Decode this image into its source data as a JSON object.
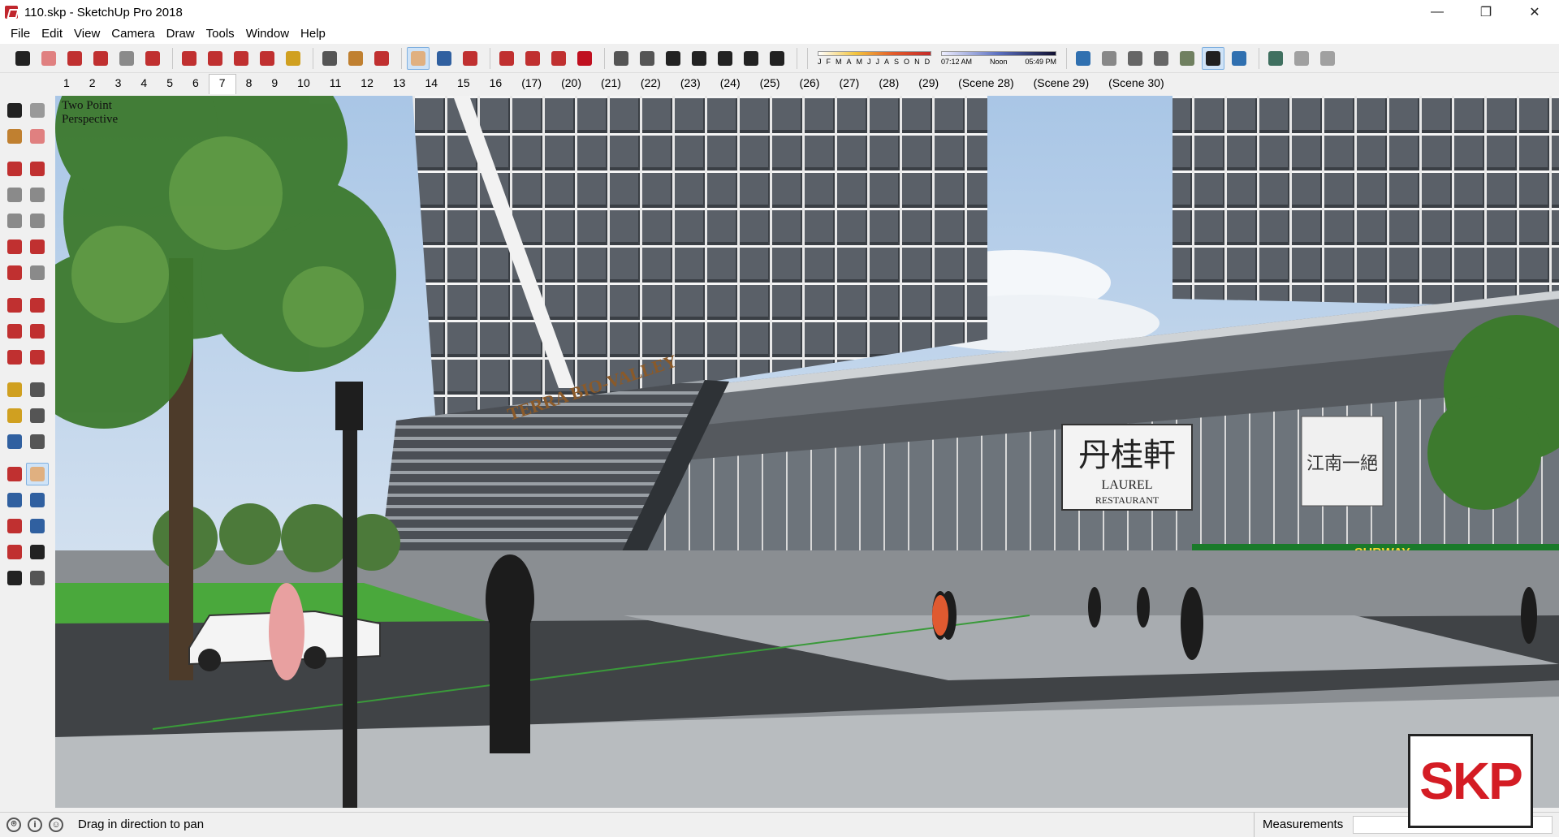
{
  "window": {
    "title": "110.skp - SketchUp Pro 2018",
    "controls": {
      "minimize": "—",
      "maximize": "❐",
      "close": "✕"
    }
  },
  "menu": [
    "File",
    "Edit",
    "View",
    "Camera",
    "Draw",
    "Tools",
    "Window",
    "Help"
  ],
  "toolbar": {
    "tools": [
      {
        "name": "select-tool-icon",
        "color": "#222222"
      },
      {
        "name": "eraser-tool-icon",
        "color": "#e08080"
      },
      {
        "name": "pencil-tool-icon",
        "color": "#c03030"
      },
      {
        "name": "arc-tool-icon",
        "color": "#c03030"
      },
      {
        "name": "rectangle-tool-icon",
        "color": "#8a8a8a"
      },
      {
        "name": "push-pull-tool-icon",
        "color": "#c03030"
      },
      {
        "name": "follow-me-tool-icon",
        "color": "#c03030"
      },
      {
        "name": "move-tool-icon",
        "color": "#c03030"
      },
      {
        "name": "rotate-tool-icon",
        "color": "#c03030"
      },
      {
        "name": "scale-tool-icon",
        "color": "#c03030"
      },
      {
        "name": "tape-measure-tool-icon",
        "color": "#d0a020"
      },
      {
        "name": "text-tool-icon",
        "color": "#555555"
      },
      {
        "name": "paint-bucket-tool-icon",
        "color": "#c08030"
      },
      {
        "name": "orbit-tool-icon",
        "color": "#c03030"
      },
      {
        "name": "pan-tool-icon",
        "color": "#e0b080"
      },
      {
        "name": "zoom-tool-icon",
        "color": "#3060a0"
      },
      {
        "name": "zoom-extents-tool-icon",
        "color": "#c03030"
      },
      {
        "name": "warehouse-icon",
        "color": "#c03030"
      },
      {
        "name": "extension-warehouse-icon",
        "color": "#c03030"
      },
      {
        "name": "send-to-layout-icon",
        "color": "#c03030"
      },
      {
        "name": "ruby-extension-icon",
        "color": "#c01020"
      },
      {
        "name": "iso-view-icon",
        "color": "#555555"
      },
      {
        "name": "top-view-icon",
        "color": "#555555"
      },
      {
        "name": "front-view-icon",
        "color": "#222222"
      },
      {
        "name": "right-view-icon",
        "color": "#222222"
      },
      {
        "name": "back-view-icon",
        "color": "#222222"
      },
      {
        "name": "left-view-icon",
        "color": "#222222"
      },
      {
        "name": "shadows-toggle-icon",
        "color": "#222222"
      }
    ],
    "shadow_months": [
      "J",
      "F",
      "M",
      "A",
      "M",
      "J",
      "J",
      "A",
      "S",
      "O",
      "N",
      "D"
    ],
    "shadow_time_start": "07:12 AM",
    "shadow_time_mid": "Noon",
    "shadow_time_end": "05:49 PM",
    "style_tools": [
      {
        "name": "xray-style-icon",
        "color": "#3070b0"
      },
      {
        "name": "back-edges-style-icon",
        "color": "#888888"
      },
      {
        "name": "wireframe-style-icon",
        "color": "#666666"
      },
      {
        "name": "hidden-line-style-icon",
        "color": "#666666"
      },
      {
        "name": "shaded-style-icon",
        "color": "#708060"
      },
      {
        "name": "shaded-textures-style-icon",
        "color": "#202020"
      },
      {
        "name": "monochrome-style-icon",
        "color": "#3070b0"
      },
      {
        "name": "geo-location-icon",
        "color": "#407060"
      },
      {
        "name": "section-plane-icon",
        "color": "#a0a0a0"
      },
      {
        "name": "section-display-icon",
        "color": "#a0a0a0"
      }
    ]
  },
  "scenes": [
    "1",
    "2",
    "3",
    "4",
    "5",
    "6",
    "7",
    "8",
    "9",
    "10",
    "11",
    "12",
    "13",
    "14",
    "15",
    "16",
    "(17)",
    "(20)",
    "(21)",
    "(22)",
    "(23)",
    "(24)",
    "(25)",
    "(26)",
    "(27)",
    "(28)",
    "(29)",
    "(Scene 28)",
    "(Scene 29)",
    "(Scene 30)"
  ],
  "active_scene": "7",
  "left_tools": [
    [
      "select-icon",
      "component-icon"
    ],
    [
      "paint-icon",
      "eraser-icon"
    ],
    [
      "line-icon",
      "freehand-icon"
    ],
    [
      "rectangle-icon",
      "rotated-rectangle-icon"
    ],
    [
      "circle-icon",
      "polygon-icon"
    ],
    [
      "arc-icon",
      "two-point-arc-icon"
    ],
    [
      "three-point-arc-icon",
      "pie-icon"
    ],
    [
      "move-icon",
      "push-pull-icon"
    ],
    [
      "rotate-icon",
      "follow-me-icon"
    ],
    [
      "scale-icon",
      "offset-icon"
    ],
    [
      "tape-measure-icon",
      "dimension-icon"
    ],
    [
      "protractor-icon",
      "text-icon"
    ],
    [
      "axes-icon",
      "3d-text-icon"
    ],
    [
      "orbit-icon",
      "pan-icon"
    ],
    [
      "zoom-icon",
      "zoom-window-icon"
    ],
    [
      "zoom-extents-icon",
      "previous-view-icon"
    ],
    [
      "position-camera-icon",
      "look-around-icon"
    ],
    [
      "walk-icon",
      "section-plane-icon"
    ]
  ],
  "viewport": {
    "label_line1": "Two Point",
    "label_line2": "Perspective",
    "signage_main": "丹桂軒",
    "signage_sub1": "LAUREL",
    "signage_sub2": "RESTAURANT",
    "signage_side": "江南一絕",
    "tower_sign": "TERRA BIO-VALLEY",
    "store_sign": "SUBWAY"
  },
  "status": {
    "message": "Drag in direction to pan",
    "measurements_label": "Measurements",
    "measurements_value": ""
  },
  "watermark": "SKP"
}
